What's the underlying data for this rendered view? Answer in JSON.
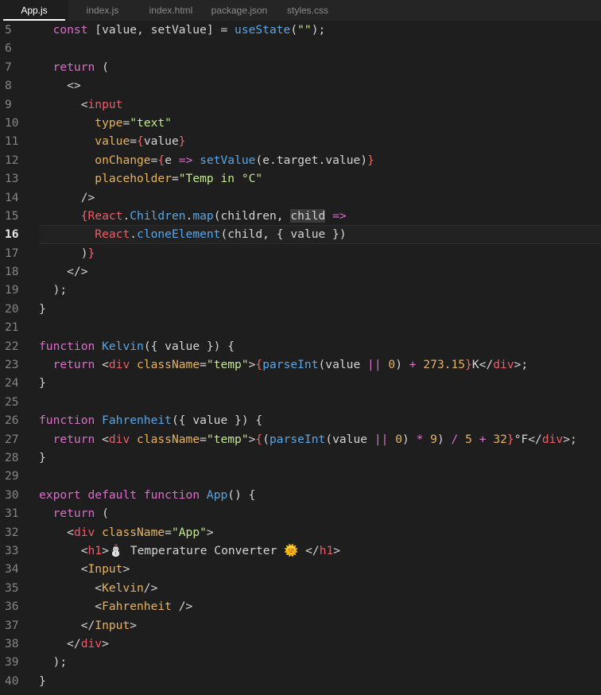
{
  "tabs": [
    {
      "label": "App.js",
      "active": true
    },
    {
      "label": "index.js",
      "active": false
    },
    {
      "label": "index.html",
      "active": false
    },
    {
      "label": "package.json",
      "active": false
    },
    {
      "label": "styles.css",
      "active": false
    }
  ],
  "editor": {
    "current_line": 16,
    "lines": [
      {
        "n": "5"
      },
      {
        "n": "6"
      },
      {
        "n": "7"
      },
      {
        "n": "8"
      },
      {
        "n": "9"
      },
      {
        "n": "10"
      },
      {
        "n": "11"
      },
      {
        "n": "12"
      },
      {
        "n": "13"
      },
      {
        "n": "14"
      },
      {
        "n": "15"
      },
      {
        "n": "16"
      },
      {
        "n": "17"
      },
      {
        "n": "18"
      },
      {
        "n": "19"
      },
      {
        "n": "20"
      },
      {
        "n": "21"
      },
      {
        "n": "22"
      },
      {
        "n": "23"
      },
      {
        "n": "24"
      },
      {
        "n": "25"
      },
      {
        "n": "26"
      },
      {
        "n": "27"
      },
      {
        "n": "28"
      },
      {
        "n": "29"
      },
      {
        "n": "30"
      },
      {
        "n": "31"
      },
      {
        "n": "32"
      },
      {
        "n": "33"
      },
      {
        "n": "34"
      },
      {
        "n": "35"
      },
      {
        "n": "36"
      },
      {
        "n": "37"
      },
      {
        "n": "38"
      },
      {
        "n": "39"
      },
      {
        "n": "40"
      }
    ],
    "tokens": {
      "l5": [
        "  ",
        "const",
        " [value, setValue] = ",
        "useState",
        "(",
        "\"\"",
        ");"
      ],
      "l7": [
        "  ",
        "return",
        " ("
      ],
      "l8": [
        "    ",
        "<>"
      ],
      "l9": [
        "      <",
        "input"
      ],
      "l10": [
        "        ",
        "type",
        "=",
        "\"text\""
      ],
      "l11": [
        "        ",
        "value",
        "=",
        "{",
        "value",
        "}"
      ],
      "l12": [
        "        ",
        "onChange",
        "=",
        "{",
        "e",
        " ",
        "=>",
        " ",
        "setValue",
        "(",
        "e",
        ".target.value)",
        "}"
      ],
      "l13": [
        "        ",
        "placeholder",
        "=",
        "\"Temp in °C\""
      ],
      "l14": [
        "      />"
      ],
      "l15": [
        "      ",
        "{",
        "React",
        ".",
        "Children",
        ".",
        "map",
        "(children, ",
        "child",
        " ",
        "=>"
      ],
      "l16": [
        "        ",
        "React",
        ".",
        "cloneElement",
        "(child, { value })"
      ],
      "l17": [
        "      )",
        "}"
      ],
      "l18": [
        "    </>"
      ],
      "l19": [
        "  );"
      ],
      "l20": [
        "}"
      ],
      "l22": [
        "function",
        " ",
        "Kelvin",
        "({ value }) {"
      ],
      "l23": [
        "  ",
        "return",
        " <",
        "div",
        " ",
        "className",
        "=",
        "\"temp\"",
        ">",
        "{",
        "parseInt",
        "(value ",
        "||",
        " ",
        "0",
        ") ",
        "+",
        " ",
        "273.15",
        "}",
        "K</",
        "div",
        ">;"
      ],
      "l24": [
        "}"
      ],
      "l26": [
        "function",
        " ",
        "Fahrenheit",
        "({ value }) {"
      ],
      "l27": [
        "  ",
        "return",
        " <",
        "div",
        " ",
        "className",
        "=",
        "\"temp\"",
        ">",
        "{",
        "(",
        "parseInt",
        "(value ",
        "||",
        " ",
        "0",
        ") ",
        "*",
        " ",
        "9",
        ") ",
        "/",
        " ",
        "5",
        " ",
        "+",
        " ",
        "32",
        "}",
        "°F</",
        "div",
        ">;"
      ],
      "l28": [
        "}"
      ],
      "l30": [
        "export",
        " ",
        "default",
        " ",
        "function",
        " ",
        "App",
        "() {"
      ],
      "l31": [
        "  ",
        "return",
        " ("
      ],
      "l32": [
        "    <",
        "div",
        " ",
        "className",
        "=",
        "\"App\"",
        ">"
      ],
      "l33": [
        "      <",
        "h1",
        ">",
        "⛄",
        " Temperature Converter ",
        "🌞",
        " </",
        "h1",
        ">"
      ],
      "l34": [
        "      <",
        "Input",
        ">"
      ],
      "l35": [
        "        <",
        "Kelvin",
        "/>"
      ],
      "l36": [
        "        <",
        "Fahrenheit",
        " />"
      ],
      "l37": [
        "      </",
        "Input",
        ">"
      ],
      "l38": [
        "    </",
        "div",
        ">"
      ],
      "l39": [
        "  );"
      ],
      "l40": [
        "}"
      ]
    }
  },
  "colors": {
    "background": "#1e1e1e",
    "keyword": "#d96fc8",
    "function": "#58a6e6",
    "string": "#c3e88d",
    "number": "#e6b35d",
    "tag": "#ee5b67"
  }
}
